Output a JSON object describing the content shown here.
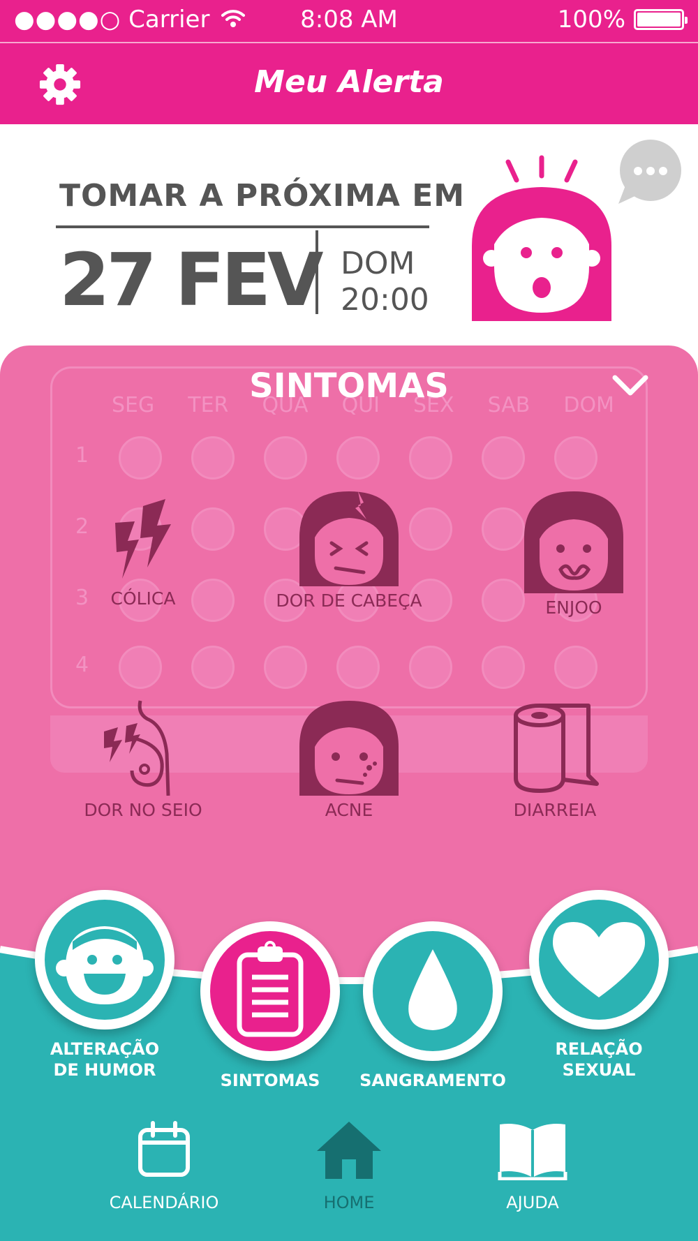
{
  "status_bar": {
    "carrier": "Carrier",
    "time": "8:08 AM",
    "battery": "100%"
  },
  "header": {
    "title": "Meu Alerta"
  },
  "next_dose": {
    "heading": "TOMAR A PRÓXIMA EM",
    "date": "27 FEV",
    "weekday": "DOM",
    "time": "20:00"
  },
  "panel": {
    "title": "SINTOMAS",
    "symptoms": [
      {
        "label": "CÓLICA"
      },
      {
        "label": "DOR DE CABEÇA"
      },
      {
        "label": "ENJOO"
      },
      {
        "label": "DOR NO SEIO"
      },
      {
        "label": "ACNE"
      },
      {
        "label": "DIARREIA"
      }
    ],
    "background_calendar": {
      "days": [
        "SEG",
        "TER",
        "QUA",
        "QUI",
        "SEX",
        "SAB",
        "DOM"
      ],
      "weeks": [
        "1",
        "2",
        "3",
        "4"
      ]
    }
  },
  "actions": [
    {
      "label_line1": "ALTERAÇÃO",
      "label_line2": "DE HUMOR"
    },
    {
      "label_line1": "SINTOMAS",
      "label_line2": ""
    },
    {
      "label_line1": "SANGRAMENTO",
      "label_line2": ""
    },
    {
      "label_line1": "RELAÇÃO",
      "label_line2": "SEXUAL"
    }
  ],
  "nav": [
    {
      "label": "CALENDÁRIO"
    },
    {
      "label": "HOME"
    },
    {
      "label": "AJUDA"
    }
  ],
  "colors": {
    "pink": "#e9218d",
    "panel_pink": "#ee6fa8",
    "teal": "#2bb3b3",
    "dark_teal": "#166f70",
    "gray": "#555555"
  }
}
